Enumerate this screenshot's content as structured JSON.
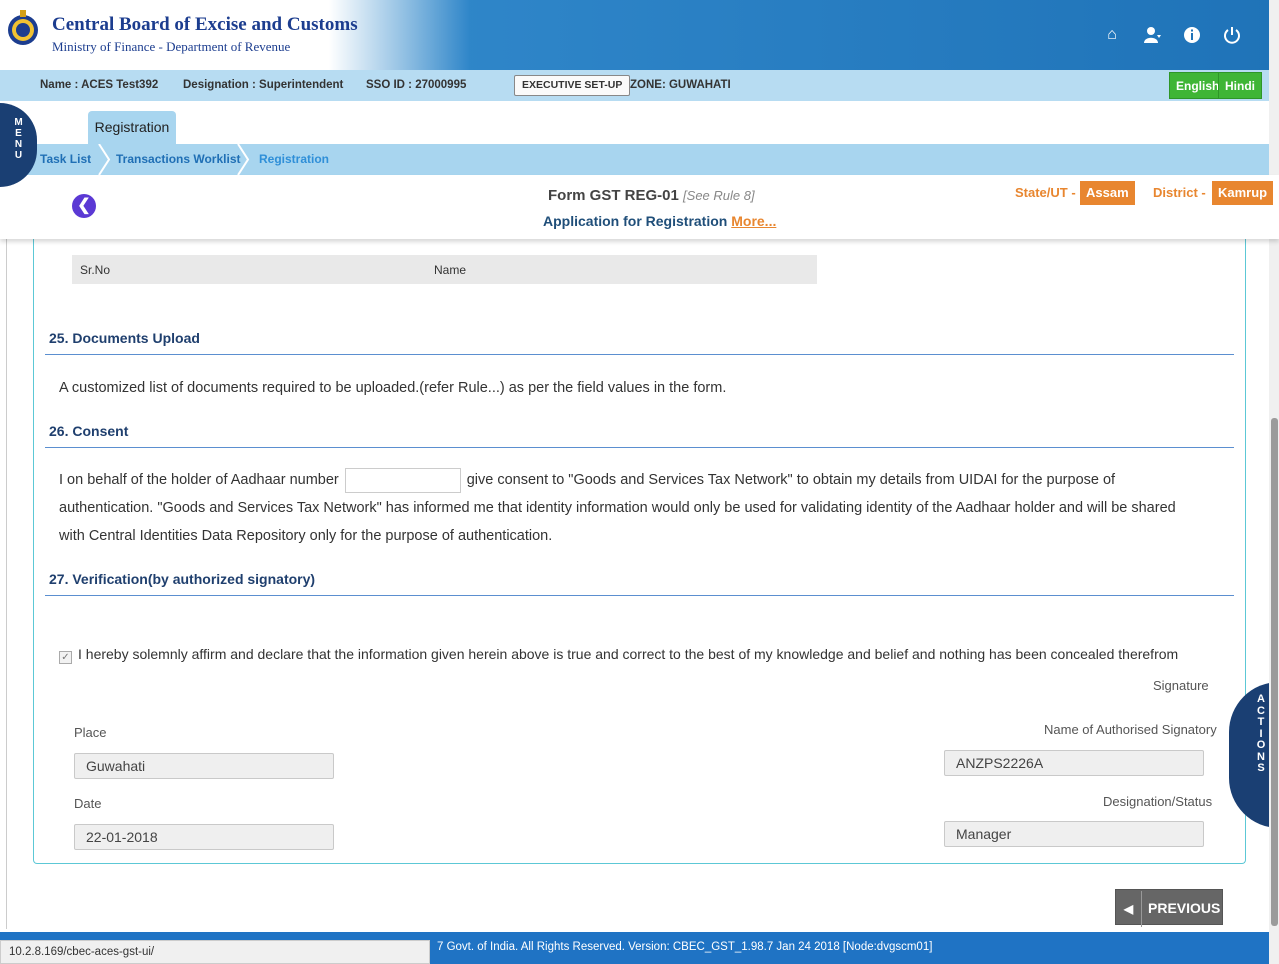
{
  "header": {
    "org_name": "Central Board of Excise and Customs",
    "org_sub": "Ministry of Finance - Department of Revenue",
    "icons": [
      "home-icon",
      "user-icon",
      "info-icon",
      "power-icon"
    ]
  },
  "infobar": {
    "name": "Name : ACES Test392",
    "designation": "Designation : Superintendent",
    "sso": "SSO ID : 27000995",
    "exec_setup": "EXECUTIVE SET-UP",
    "zone": "ZONE: GUWAHATI",
    "lang_english": "English",
    "lang_hindi": "Hindi"
  },
  "menu_tab": "MENU",
  "active_tab": "Registration",
  "breadcrumb": [
    "Task List",
    "Transactions Worklist",
    "Registration"
  ],
  "form": {
    "title": "Form GST REG-01",
    "rule": "[See Rule 8]",
    "subtitle": "Application for Registration",
    "more": "More...",
    "state_label": "State/UT -",
    "state_value": "Assam",
    "district_label": "District -",
    "district_value": "Kamrup"
  },
  "table": {
    "col1": "Sr.No",
    "col2": "Name"
  },
  "sections": {
    "s25_title": "25. Documents Upload",
    "s25_text": "A customized list of documents required to be uploaded.(refer Rule...) as per the field values in the form.",
    "s26_title": "26. Consent",
    "s26_text_a": "I on behalf of the holder of Aadhaar number",
    "s26_text_b": "give consent to \"Goods and Services Tax Network\" to obtain my details from UIDAI for the purpose of",
    "s26_text_c": "authentication. \"Goods and Services Tax Network\" has informed me that identity information would only be used for validating identity of the Aadhaar holder and will be shared",
    "s26_text_d": "with Central Identities Data Repository only for the purpose of authentication.",
    "s27_title": "27. Verification(by authorized signatory)",
    "declaration": "I hereby solemnly affirm and declare that the information given herein above is true and correct to the best of my knowledge and belief and nothing has been concealed therefrom"
  },
  "verification": {
    "declaration_checked": true,
    "signature_label": "Signature",
    "place_label": "Place",
    "place_value": "Guwahati",
    "date_label": "Date",
    "date_value": "22-01-2018",
    "auth_label": "Name of Authorised Signatory",
    "auth_value": "ANZPS2226A",
    "desig_label": "Designation/Status",
    "desig_value": "Manager"
  },
  "actions_tab": "ACTIONS",
  "previous_button": "PREVIOUS",
  "footer": {
    "text": "7 Govt. of India. All Rights Reserved. Version: CBEC_GST_1.98.7 Jan 24 2018     [Node:dvgscm01]",
    "status_url": "10.2.8.169/cbec-aces-gst-ui/"
  },
  "colors": {
    "accent_orange": "#e8862f",
    "header_blue": "#1f73b8",
    "navy": "#1a3f73",
    "green": "#3fb536"
  }
}
